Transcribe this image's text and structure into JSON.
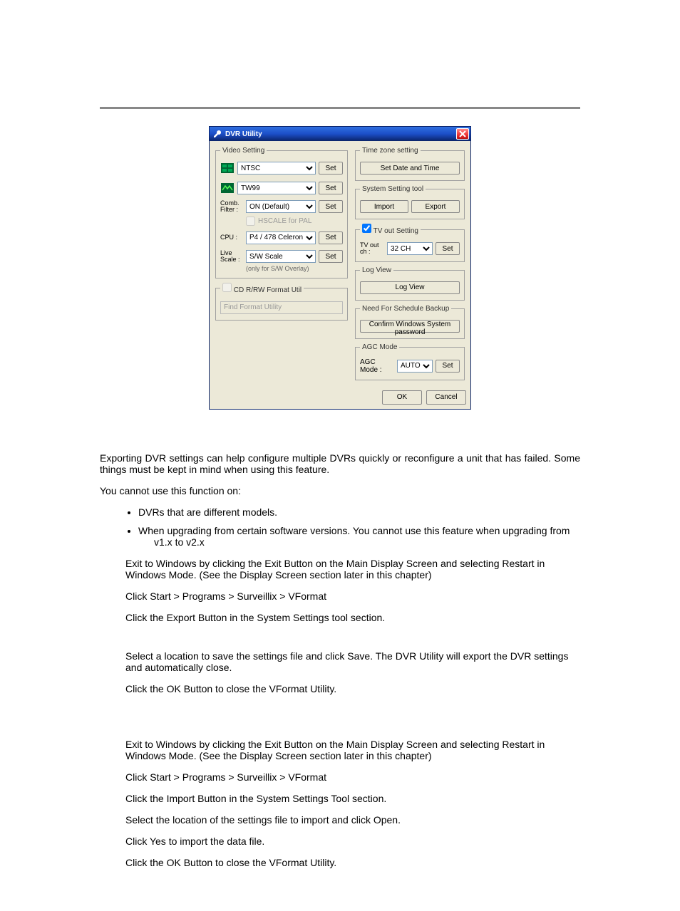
{
  "dialog": {
    "title": "DVR Utility",
    "video_setting": {
      "legend": "Video Setting",
      "std_value": "NTSC",
      "chip_value": "TW99",
      "comb_label": "Comb. Filter :",
      "comb_value": "ON (Default)",
      "hscale_label": "HSCALE for PAL",
      "cpu_label": "CPU :",
      "cpu_value": "P4 / 478 Celeron",
      "live_label": "Live Scale :",
      "live_value": "S/W Scale",
      "live_note": "(only for S/W Overlay)",
      "set": "Set"
    },
    "cd": {
      "legend": "CD R/RW Format Util",
      "input": "Find Format Utility"
    },
    "tz": {
      "legend": "Time zone setting",
      "btn": "Set Date and Time"
    },
    "sys": {
      "legend": "System Setting tool",
      "import": "Import",
      "export": "Export"
    },
    "tvout": {
      "legend": "TV out Setting",
      "ch_label": "TV out ch :",
      "ch_value": "32 CH",
      "set": "Set"
    },
    "log": {
      "legend": "Log View",
      "btn": "Log View"
    },
    "backup": {
      "legend": "Need For Schedule Backup",
      "btn": "Confirm Windows System password"
    },
    "agc": {
      "legend": "AGC Mode",
      "label": "AGC Mode :",
      "value": "AUTO",
      "set": "Set"
    },
    "ok": "OK",
    "cancel": "Cancel"
  },
  "doc": {
    "intro": "Exporting DVR settings can help configure multiple DVRs quickly or reconfigure a unit that has failed. Some things must be kept in mind when using this feature.",
    "cannot": "You cannot use this function on:",
    "li1": "DVRs that are different models.",
    "li2a": "When upgrading from certain software versions. You cannot use this feature when upgrading from",
    "li2b": "v1.x to v2.x",
    "export": {
      "s1": "Exit to Windows by clicking the Exit Button on the Main Display Screen and selecting Restart in Windows Mode. (See the Display Screen section later in this chapter)",
      "s2": "Click Start > Programs > Surveillix > VFormat",
      "s3": "Click the Export Button in the System Settings tool section.",
      "s4": "Select a location to save the settings file and click Save. The DVR Utility will export the DVR settings and automatically close.",
      "s5": "Click the OK Button to close the VFormat Utility."
    },
    "import": {
      "s1": "Exit to Windows by clicking the Exit Button on the Main Display Screen and selecting Restart in Windows Mode. (See the Display Screen section later in this chapter)",
      "s2": "Click Start > Programs > Surveillix > VFormat",
      "s3": "Click the Import Button in the System Settings Tool section.",
      "s4": "Select the location of the settings file to import and click Open.",
      "s5": "Click Yes to import the data file.",
      "s6": "Click the OK Button to close the VFormat Utility."
    }
  }
}
